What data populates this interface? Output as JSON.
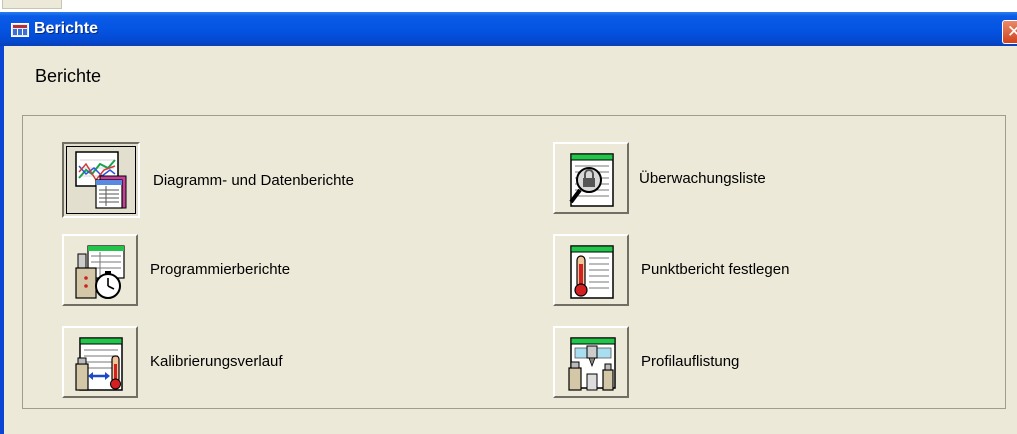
{
  "window": {
    "title": "Berichte",
    "close_glyph": "✕",
    "accent_color": "#0554e3"
  },
  "heading": "Berichte",
  "reports": [
    {
      "label": "Diagramm- und Datenberichte",
      "icon": "chart-report-icon",
      "state": "pressed"
    },
    {
      "label": "Überwachungsliste",
      "icon": "monitor-list-icon"
    },
    {
      "label": "Programmierberichte",
      "icon": "programming-report-icon"
    },
    {
      "label": "Punktbericht festlegen",
      "icon": "point-report-icon"
    },
    {
      "label": "Kalibrierungsverlauf",
      "icon": "calibration-history-icon"
    },
    {
      "label": "Profilauflistung",
      "icon": "profile-listing-icon"
    }
  ]
}
